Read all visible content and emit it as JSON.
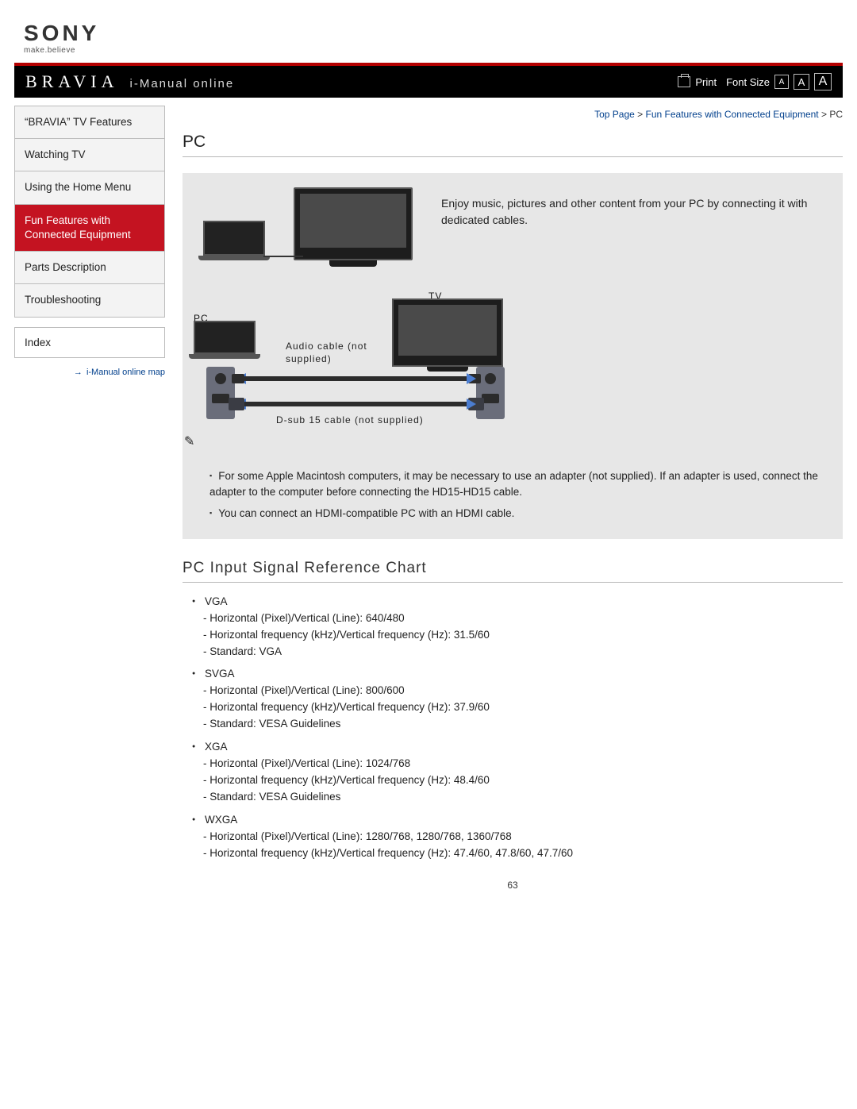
{
  "logo": {
    "brand": "SONY",
    "tagline": "make.believe"
  },
  "header": {
    "bravia": "BRAVIA",
    "title": "i-Manual online",
    "print": "Print",
    "font_size_label": "Font Size",
    "fs_a": "A"
  },
  "breadcrumb": {
    "top": "Top Page",
    "mid": "Fun Features with Connected Equipment",
    "leaf": "PC",
    "sep": " > "
  },
  "sidebar": {
    "items": [
      "“BRAVIA” TV Features",
      "Watching TV",
      "Using the Home Menu",
      "Fun Features with Connected Equipment",
      "Parts Description",
      "Troubleshooting"
    ],
    "index": "Index",
    "map_link": "i-Manual online map"
  },
  "page": {
    "title": "PC",
    "hero_text": "Enjoy music, pictures and other content from your PC by connecting it with dedicated cables.",
    "diagram": {
      "pc": "PC",
      "tv": "TV",
      "audio_cable": "Audio cable (not supplied)",
      "dsub_cable": "D-sub 15 cable (not supplied)"
    },
    "notes": [
      "For some Apple Macintosh computers, it may be necessary to use an adapter (not supplied). If an adapter is used, connect the adapter to the computer before connecting the HD15-HD15 cable.",
      "You can connect an HDMI-compatible PC with an HDMI cable."
    ],
    "section2_title": "PC Input Signal Reference Chart",
    "signals": [
      {
        "name": "VGA",
        "lines": [
          "Horizontal (Pixel)/Vertical (Line): 640/480",
          "Horizontal frequency (kHz)/Vertical frequency (Hz): 31.5/60",
          "Standard: VGA"
        ]
      },
      {
        "name": "SVGA",
        "lines": [
          "Horizontal (Pixel)/Vertical (Line): 800/600",
          "Horizontal frequency (kHz)/Vertical frequency (Hz): 37.9/60",
          "Standard: VESA Guidelines"
        ]
      },
      {
        "name": "XGA",
        "lines": [
          "Horizontal (Pixel)/Vertical (Line): 1024/768",
          "Horizontal frequency (kHz)/Vertical frequency (Hz): 48.4/60",
          "Standard: VESA Guidelines"
        ]
      },
      {
        "name": "WXGA",
        "lines": [
          "Horizontal (Pixel)/Vertical (Line): 1280/768, 1280/768, 1360/768",
          "Horizontal frequency (kHz)/Vertical frequency (Hz): 47.4/60, 47.8/60, 47.7/60"
        ]
      }
    ],
    "page_number": "63"
  }
}
